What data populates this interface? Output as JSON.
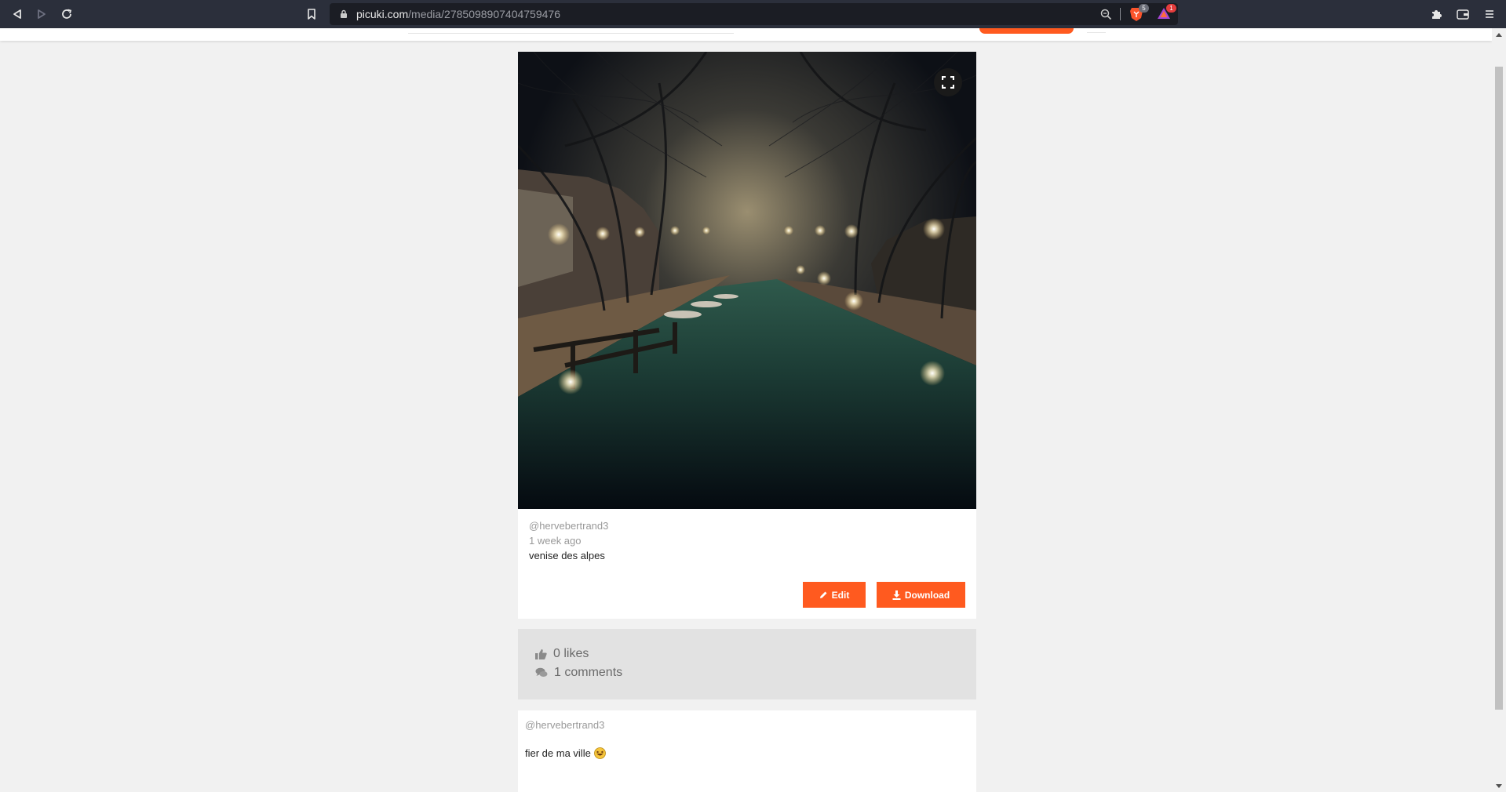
{
  "browser": {
    "url_domain": "picuki.com",
    "url_path": "/media/2785098907404759476",
    "brave_shields_count": "5",
    "rewards_count": "1"
  },
  "post": {
    "username": "@hervebertrand3",
    "time_ago": "1 week ago",
    "caption": "venise des alpes",
    "edit_label": "Edit",
    "download_label": "Download",
    "image_subject": "night-canal-photo"
  },
  "stats": {
    "likes": "0 likes",
    "comments": "1 comments"
  },
  "comments": [
    {
      "username": "@hervebertrand3",
      "text": "fier de ma ville"
    }
  ],
  "colors": {
    "accent": "#ff5a1f",
    "chrome": "#2b2f3b",
    "background": "#f1f1f1"
  }
}
